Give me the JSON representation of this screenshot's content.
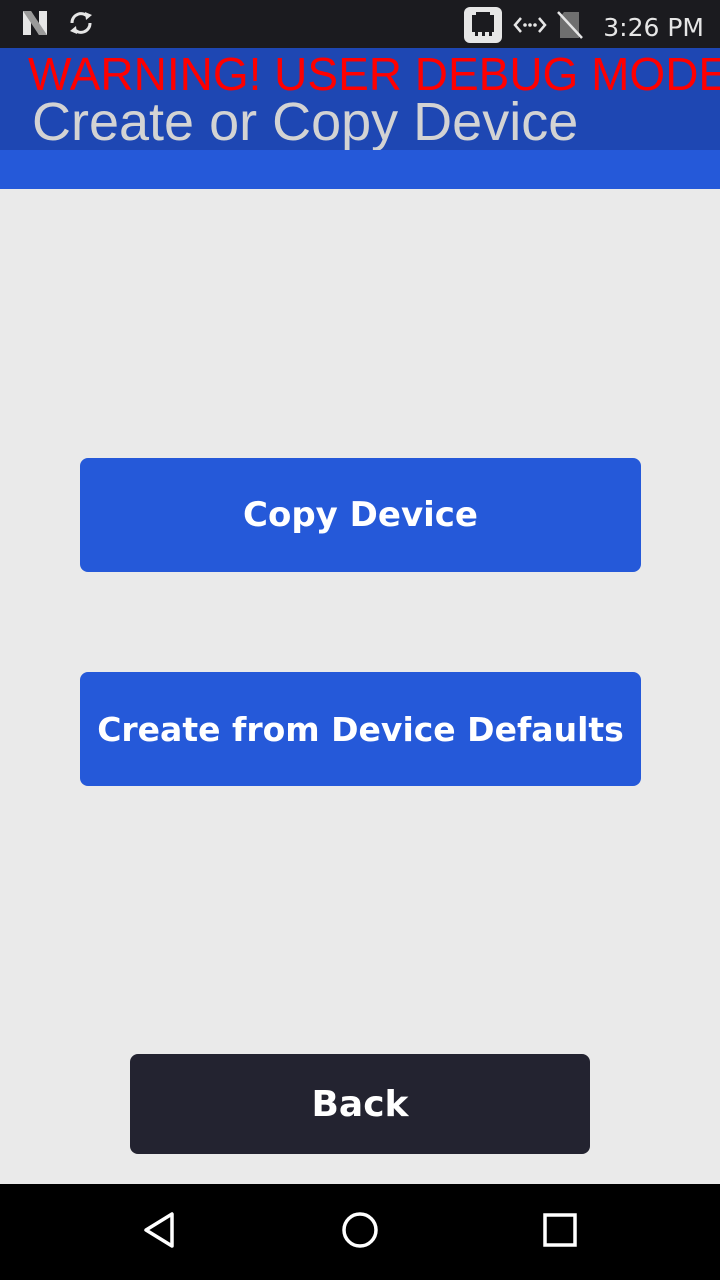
{
  "status_bar": {
    "time": "3:26 PM",
    "icons": [
      "n-logo-icon",
      "sync-icon",
      "ethernet-icon",
      "data-transfer-icon",
      "no-sim-icon"
    ]
  },
  "header": {
    "warning": "WARNING! USER DEBUG MODE",
    "title": "Create or Copy Device"
  },
  "buttons": {
    "copy_device": "Copy Device",
    "create_from_defaults": "Create from Device Defaults",
    "back": "Back"
  },
  "nav_bar": {
    "icons": [
      "back-triangle-icon",
      "home-circle-icon",
      "recents-square-icon"
    ]
  },
  "colors": {
    "header_bg": "#1e47b3",
    "primary_button": "#2559d9",
    "warning_text": "#ff0000",
    "back_button": "#232330",
    "background": "#eaeaea"
  }
}
